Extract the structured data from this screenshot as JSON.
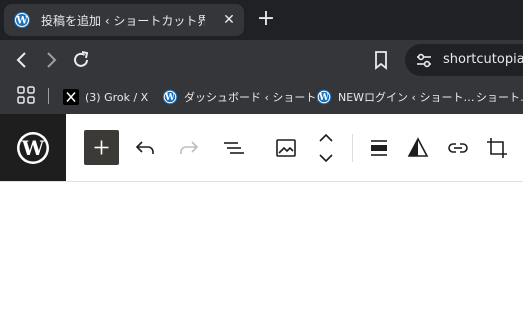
{
  "browser": {
    "tab": {
      "title": "投稿を追加 ‹ ショートカット界/Shortcutopia",
      "favicon": "wordpress-icon"
    },
    "new_tab_icon": "plus-icon",
    "address": {
      "url_display": "shortcutopia.",
      "site_info_icon": "tune-icon"
    },
    "bookmarks": [
      {
        "label": "(3) Grok / X",
        "icon": "x-logo-icon"
      },
      {
        "label": "ダッシュボード ‹ ショート…",
        "icon": "wordpress-icon"
      },
      {
        "label": "NEWログイン ‹ ショート…",
        "icon": "wordpress-icon"
      },
      {
        "label": "ショート…",
        "icon": "wordpress-icon"
      }
    ],
    "apps_icon": "apps-grid-icon"
  },
  "editor_toolbar": {
    "logo": "wordpress-logo-icon",
    "tools": [
      "add-block-icon",
      "undo-icon",
      "redo-icon",
      "document-overview-icon",
      "image-icon",
      "move-up-down-icon",
      "align-icon",
      "contrast-icon",
      "link-icon",
      "crop-icon"
    ]
  },
  "colors": {
    "browser_dark": "#202124",
    "browser_toolbar": "#35363a",
    "wp_blue": "#1d6fb8",
    "wp_dark": "#1e1e1e",
    "add_button": "#3c3a37"
  }
}
